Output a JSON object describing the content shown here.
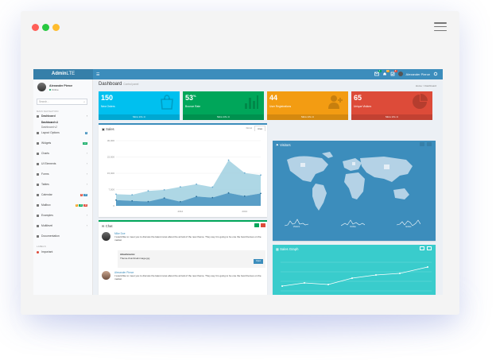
{
  "window": {
    "colors": {
      "red": "#ff5f57",
      "green": "#28c840",
      "yellow": "#febc2e"
    }
  },
  "topbar": {
    "logo_bold": "Admin",
    "logo_light": "LTE",
    "toggle_icon": "☰",
    "user_name": "Alexander Pierce",
    "badges": [
      "4",
      "10",
      "9"
    ]
  },
  "sidebar": {
    "user_name": "Alexander Pierce",
    "user_status": "Online",
    "search_placeholder": "Search...",
    "main_header": "MAIN NAVIGATION",
    "items": [
      {
        "label": "Dashboard"
      },
      {
        "label": "Layout Options",
        "badge": "4"
      },
      {
        "label": "Widgets",
        "badge": "new"
      },
      {
        "label": "Charts"
      },
      {
        "label": "UI Elements"
      },
      {
        "label": "Forms"
      },
      {
        "label": "Tables"
      },
      {
        "label": "Calendar",
        "badges": [
          "3",
          "17"
        ]
      },
      {
        "label": "Mailbox",
        "badges": [
          "5",
          "12",
          "16"
        ]
      },
      {
        "label": "Examples"
      },
      {
        "label": "Multilevel"
      },
      {
        "label": "Documentation"
      }
    ],
    "sub_items": [
      "Dashboard v1",
      "Dashboard v2"
    ],
    "labels_header": "LABELS",
    "label_items": [
      "Important"
    ]
  },
  "content": {
    "title": "Dashboard",
    "subtitle": "Control panel",
    "breadcrumb": "Home > Dashboard"
  },
  "stat_boxes": [
    {
      "value": "150",
      "suffix": "",
      "label": "New Orders",
      "footer": "More info",
      "color": "#00c0ef",
      "icon": "shopping-bag-icon"
    },
    {
      "value": "53",
      "suffix": "%",
      "label": "Bounce Rate",
      "footer": "More info",
      "color": "#00a65a",
      "icon": "bar-chart-icon"
    },
    {
      "value": "44",
      "suffix": "",
      "label": "User Registrations",
      "footer": "More info",
      "color": "#f39c12",
      "icon": "person-add-icon"
    },
    {
      "value": "65",
      "suffix": "",
      "label": "Unique Visitors",
      "footer": "More info",
      "color": "#dd4b39",
      "icon": "pie-chart-icon"
    }
  ],
  "sales": {
    "title": "Sales",
    "tabs": [
      "Donut",
      "Area"
    ],
    "active_tab": "Area"
  },
  "chart_data": {
    "type": "area",
    "x": [
      "2011 Q1",
      "2011 Q2",
      "2011 Q3",
      "2011 Q4",
      "2012 Q1",
      "2012 Q2",
      "2012 Q3",
      "2012 Q4",
      "2013 Q1",
      "2013 Q2"
    ],
    "series": [
      {
        "values": [
          2666,
          2778,
          4912,
          3767,
          6810,
          5670,
          4820,
          15073,
          10687,
          8432
        ]
      },
      {
        "values": [
          2666,
          2294,
          1969,
          3597,
          1914,
          4293,
          3795,
          5967,
          4460,
          5713
        ]
      }
    ],
    "y_ticks": [
      "0",
      "7,500",
      "15,000",
      "22,500",
      "30,000"
    ],
    "x_ticks": [
      "2012",
      "2013"
    ],
    "ylim": [
      0,
      30000
    ],
    "colors": [
      "#a0d0e0",
      "#3c8dbc"
    ]
  },
  "chat": {
    "title": "Chat",
    "messages": [
      {
        "name": "Mike Doe",
        "time": "2:15",
        "text": "I would like to meet you to discuss the latest news about the arrival of the new theme. They say it is going to be one the best themes on the market"
      },
      {
        "name": "Alexander Pierce",
        "time": "5:15",
        "text": "I would like to meet you to discuss the latest news about the arrival of the new theme. They say it is going to be one the best themes on the market"
      }
    ],
    "attachment_label": "Attachments:",
    "attachment_file": "Theme-thumbnail-image.jpg",
    "open_label": "Open"
  },
  "visitors": {
    "title": "Visitors",
    "spark_labels": [
      "Visitors",
      "Online",
      "Exists"
    ]
  },
  "sales_graph": {
    "title": "Sales Graph"
  }
}
